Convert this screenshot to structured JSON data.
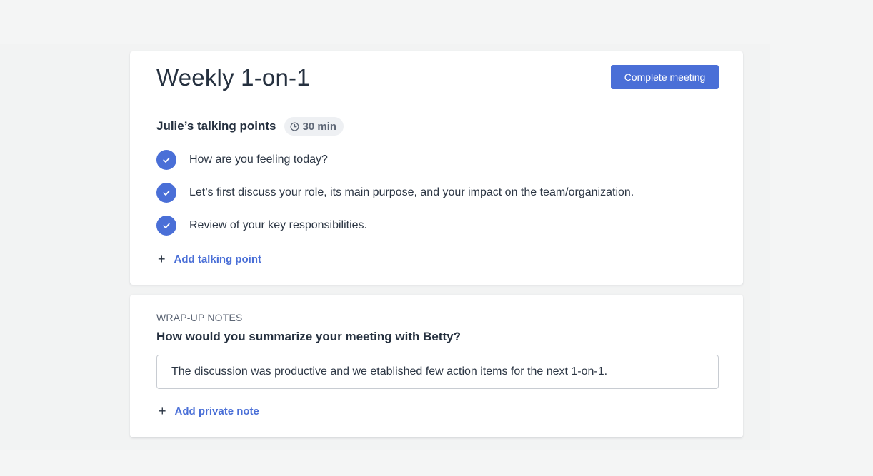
{
  "meeting": {
    "title": "Weekly 1-on-1",
    "complete_label": "Complete meeting"
  },
  "talking_points": {
    "title": "Julie’s talking points",
    "duration": "30 min",
    "items": [
      {
        "text": "How are you feeling today?",
        "checked": true
      },
      {
        "text": "Let’s first discuss your role, its main purpose, and your impact on the team/organization.",
        "checked": true
      },
      {
        "text": "Review of your key responsibilities.",
        "checked": true
      }
    ],
    "add_label": "Add talking point"
  },
  "wrap_up": {
    "label": "WRAP-UP NOTES",
    "question": "How would you summarize your meeting with Betty?",
    "summary_value": "The discussion was productive and we etablished few action items for the next 1-on-1.",
    "add_label": "Add private note"
  },
  "icons": {
    "clock": "clock-icon",
    "check": "check-icon",
    "plus": "plus-icon"
  },
  "colors": {
    "accent": "#4a6fd7",
    "text": "#25303f",
    "muted": "#5d6675"
  }
}
